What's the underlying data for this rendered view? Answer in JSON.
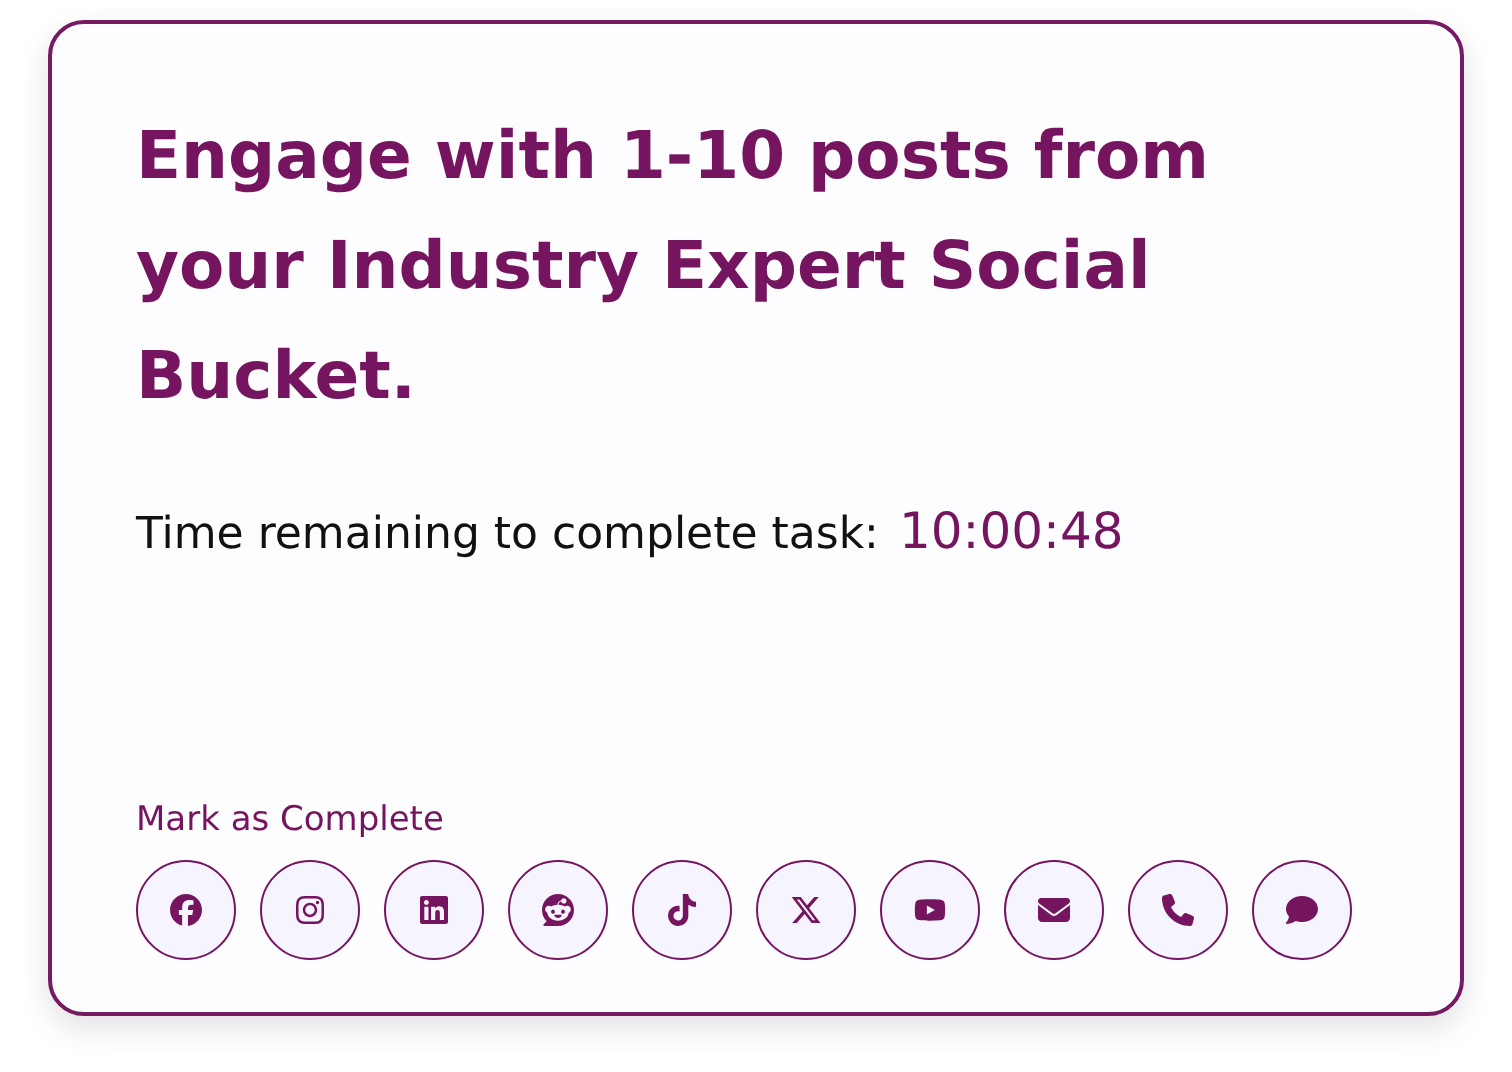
{
  "title": "Engage with 1-10 posts from your Industry Expert Social Bucket.",
  "timer": {
    "label": "Time remaining to complete task:",
    "value": "10:00:48"
  },
  "complete_link": "Mark as Complete",
  "share_buttons": [
    {
      "kind": "facebook"
    },
    {
      "kind": "instagram"
    },
    {
      "kind": "linkedin"
    },
    {
      "kind": "reddit"
    },
    {
      "kind": "tiktok"
    },
    {
      "kind": "x"
    },
    {
      "kind": "youtube"
    },
    {
      "kind": "email"
    },
    {
      "kind": "phone"
    },
    {
      "kind": "chat"
    }
  ]
}
